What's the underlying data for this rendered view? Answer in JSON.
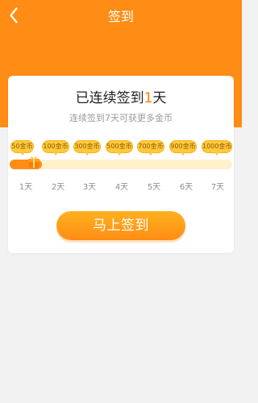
{
  "header": {
    "title": "签到"
  },
  "summary": {
    "prefix": "已连续签到",
    "days": "1",
    "suffix": "天",
    "hint": "连续签到7天可获更多金币"
  },
  "rewards": [
    {
      "label": "50金币"
    },
    {
      "label": "100金币"
    },
    {
      "label": "300金币"
    },
    {
      "label": "500金币"
    },
    {
      "label": "700金币"
    },
    {
      "label": "900金币"
    },
    {
      "label": "1000金币"
    }
  ],
  "days": [
    {
      "label": "1天"
    },
    {
      "label": "2天"
    },
    {
      "label": "3天"
    },
    {
      "label": "4天"
    },
    {
      "label": "5天"
    },
    {
      "label": "6天"
    },
    {
      "label": "7天"
    }
  ],
  "progress": {
    "value": 1,
    "max": 7
  },
  "actions": {
    "checkin_label": "马上签到"
  },
  "colors": {
    "primary": "#ff8c14",
    "accent": "#ff7b00",
    "reward": "#ffc93c",
    "track": "#fff1cc"
  },
  "icons": {
    "back": "chevron-left-icon",
    "gift": "gift-icon"
  }
}
